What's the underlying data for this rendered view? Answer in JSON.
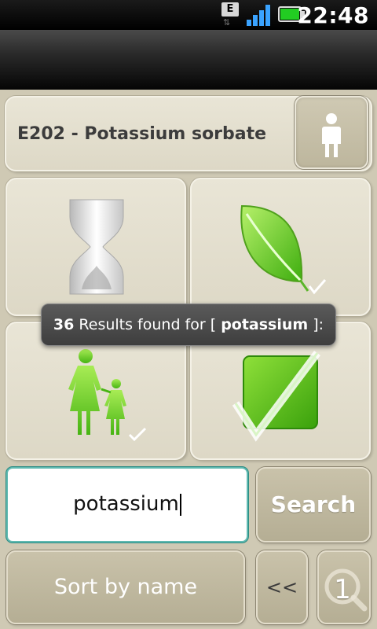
{
  "status_bar": {
    "network_type": "E",
    "time": "22:48",
    "icons": [
      "data-transfer-icon",
      "signal-icon",
      "battery-icon"
    ],
    "battery_color": "#22cc22",
    "signal_color": "#3aa3ff"
  },
  "header": {
    "title": "E202 - Potassium sorbate",
    "person_icon": "person-icon"
  },
  "tiles": [
    {
      "icon": "hourglass-icon"
    },
    {
      "icon": "leaf-check-icon"
    },
    {
      "icon": "mother-child-check-icon"
    },
    {
      "icon": "checkbox-check-icon"
    }
  ],
  "toast": {
    "count": "36",
    "prefix": "Results found for [",
    "query": "potassium",
    "suffix": "]:"
  },
  "search": {
    "value": "potassium",
    "button_label": "Search"
  },
  "footer": {
    "sort_label": "Sort by name",
    "prev_label": "<<",
    "page_number": "1",
    "page_icon": "magnifier-icon"
  },
  "colors": {
    "background": "#cfc9b4",
    "accent_green": "#6fd22a",
    "input_border": "#5fb9b0"
  }
}
